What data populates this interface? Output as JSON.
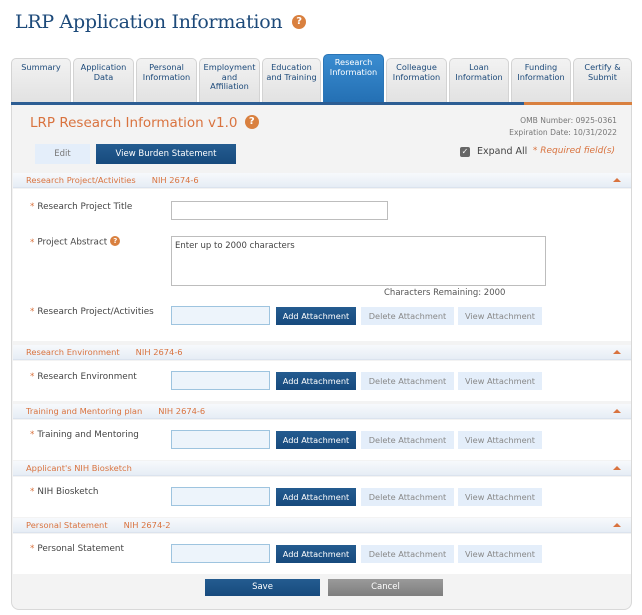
{
  "page": {
    "title": "LRP Application Information",
    "help_icon": "?"
  },
  "tabs": [
    {
      "label": "Summary",
      "active": false
    },
    {
      "label": "Application Data",
      "active": false
    },
    {
      "label": "Personal Information",
      "active": false
    },
    {
      "label": "Employment and Affiliation",
      "active": false
    },
    {
      "label": "Education and Training",
      "active": false
    },
    {
      "label": "Research Information",
      "active": true
    },
    {
      "label": "Colleague Information",
      "active": false
    },
    {
      "label": "Loan Information",
      "active": false
    },
    {
      "label": "Funding Information",
      "active": false
    },
    {
      "label": "Certify & Submit",
      "active": false
    }
  ],
  "form": {
    "title": "LRP Research Information v1.0",
    "omb_number": "OMB Number: 0925-0361",
    "expiration": "Expiration Date: 10/31/2022",
    "edit_label": "Edit",
    "burden_label": "View Burden Statement",
    "expand_all_label": "Expand All",
    "expand_all_checked": true,
    "required_note": "* Required field(s)",
    "save_label": "Save",
    "cancel_label": "Cancel"
  },
  "attachment_buttons": {
    "add": "Add Attachment",
    "delete": "Delete Attachment",
    "view": "View Attachment"
  },
  "sections": [
    {
      "header": "Research Project/Activities",
      "form_no": "NIH 2674-6",
      "fields": [
        {
          "label": "Research Project Title",
          "type": "text",
          "value": ""
        },
        {
          "label": "Project Abstract",
          "type": "textarea",
          "placeholder": "Enter up to 2000 characters",
          "chars_remaining": "Characters Remaining: 2000"
        },
        {
          "label": "Research Project/Activities",
          "type": "attachment"
        }
      ]
    },
    {
      "header": "Research Environment",
      "form_no": "NIH 2674-6",
      "fields": [
        {
          "label": "Research Environment",
          "type": "attachment"
        }
      ]
    },
    {
      "header": "Training and Mentoring plan",
      "form_no": "NIH 2674-6",
      "fields": [
        {
          "label": "Training and Mentoring",
          "type": "attachment"
        }
      ]
    },
    {
      "header": "Applicant's NIH Biosketch",
      "form_no": "",
      "fields": [
        {
          "label": "NIH Biosketch",
          "type": "attachment"
        }
      ]
    },
    {
      "header": "Personal Statement",
      "form_no": "NIH 2674-2",
      "fields": [
        {
          "label": "Personal Statement",
          "type": "attachment"
        }
      ]
    }
  ],
  "required_marker": "*",
  "colors": {
    "brand_blue": "#1d4a7a",
    "active_tab": "#2c7bc2",
    "accent_orange": "#d9733f",
    "primary_button": "#1f5586",
    "secondary_button": "#e4eefa",
    "cancel_button": "#8a8a8a"
  }
}
